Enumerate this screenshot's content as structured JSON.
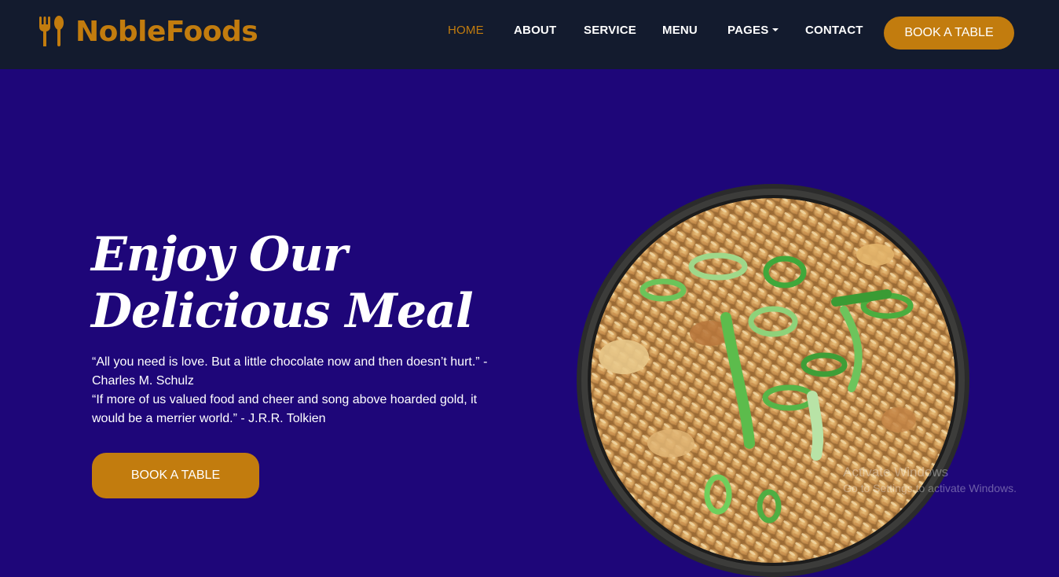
{
  "brand": {
    "name": "NobleFoods",
    "icon": "utensils-icon",
    "color": "#c27c0e"
  },
  "nav": {
    "items": [
      {
        "label": "HOME",
        "active": true
      },
      {
        "label": "ABOUT"
      },
      {
        "label": "SERVICE"
      },
      {
        "label": "MENU"
      },
      {
        "label": "PAGES",
        "dropdown": true
      },
      {
        "label": "CONTACT"
      }
    ],
    "cta_label": "BOOK A TABLE"
  },
  "hero": {
    "title": "Enjoy Our\nDelicious Meal",
    "quote1": "“All you need is love. But a little chocolate now and then doesn’t hurt.” - Charles M. Schulz",
    "quote2": "“If more of us valued food and cheer and song above hoarded gold, it would be a merrier world.” - J.R.R. Tolkien",
    "cta_label": "BOOK A TABLE",
    "image": "fried-rice-bowl"
  },
  "watermark": {
    "title": "Activate Windows",
    "subtitle": "Go to Settings to activate Windows."
  },
  "colors": {
    "navbar": "#131b2e",
    "hero_bg": "#1e0679",
    "accent": "#c27c0e",
    "text": "#ffffff"
  }
}
